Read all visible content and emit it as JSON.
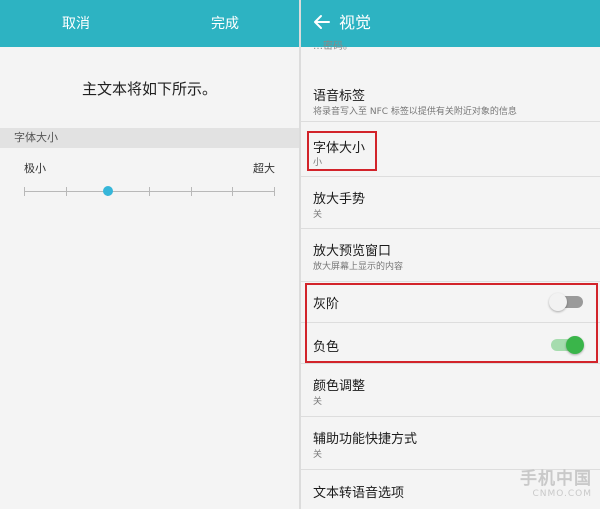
{
  "left": {
    "cancel": "取消",
    "done": "完成",
    "preview_text": "主文本将如下所示。",
    "section_header": "字体大小",
    "scale_min": "极小",
    "scale_max": "超大",
    "slider_level": 0.333,
    "slider_steps": 7
  },
  "right": {
    "title": "视觉",
    "partial_text": "…密码。",
    "items": {
      "voice_label": {
        "title": "语音标签",
        "sub": "将录音写入至 NFC 标签以提供有关附近对象的信息"
      },
      "font_size": {
        "title": "字体大小",
        "sub": "小"
      },
      "magnify": {
        "title": "放大手势",
        "sub": "关"
      },
      "magnify_window": {
        "title": "放大预览窗口",
        "sub": "放大屏幕上显示的内容"
      },
      "grayscale": {
        "title": "灰阶",
        "on": false
      },
      "negative": {
        "title": "负色",
        "on": true
      },
      "color_adjust": {
        "title": "颜色调整",
        "sub": "关"
      },
      "shortcut": {
        "title": "辅助功能快捷方式",
        "sub": "关"
      },
      "tts": {
        "title": "文本转语音选项"
      }
    }
  },
  "watermark": {
    "main": "手机中国",
    "sub": "CNMO.COM"
  },
  "colors": {
    "header": "#2db3c2",
    "accent": "#36b6d9",
    "toggle_on": "#3ab54a",
    "toggle_off": "#9a9a9a",
    "highlight": "#d2232a"
  },
  "icons": [
    "back-arrow-icon"
  ]
}
